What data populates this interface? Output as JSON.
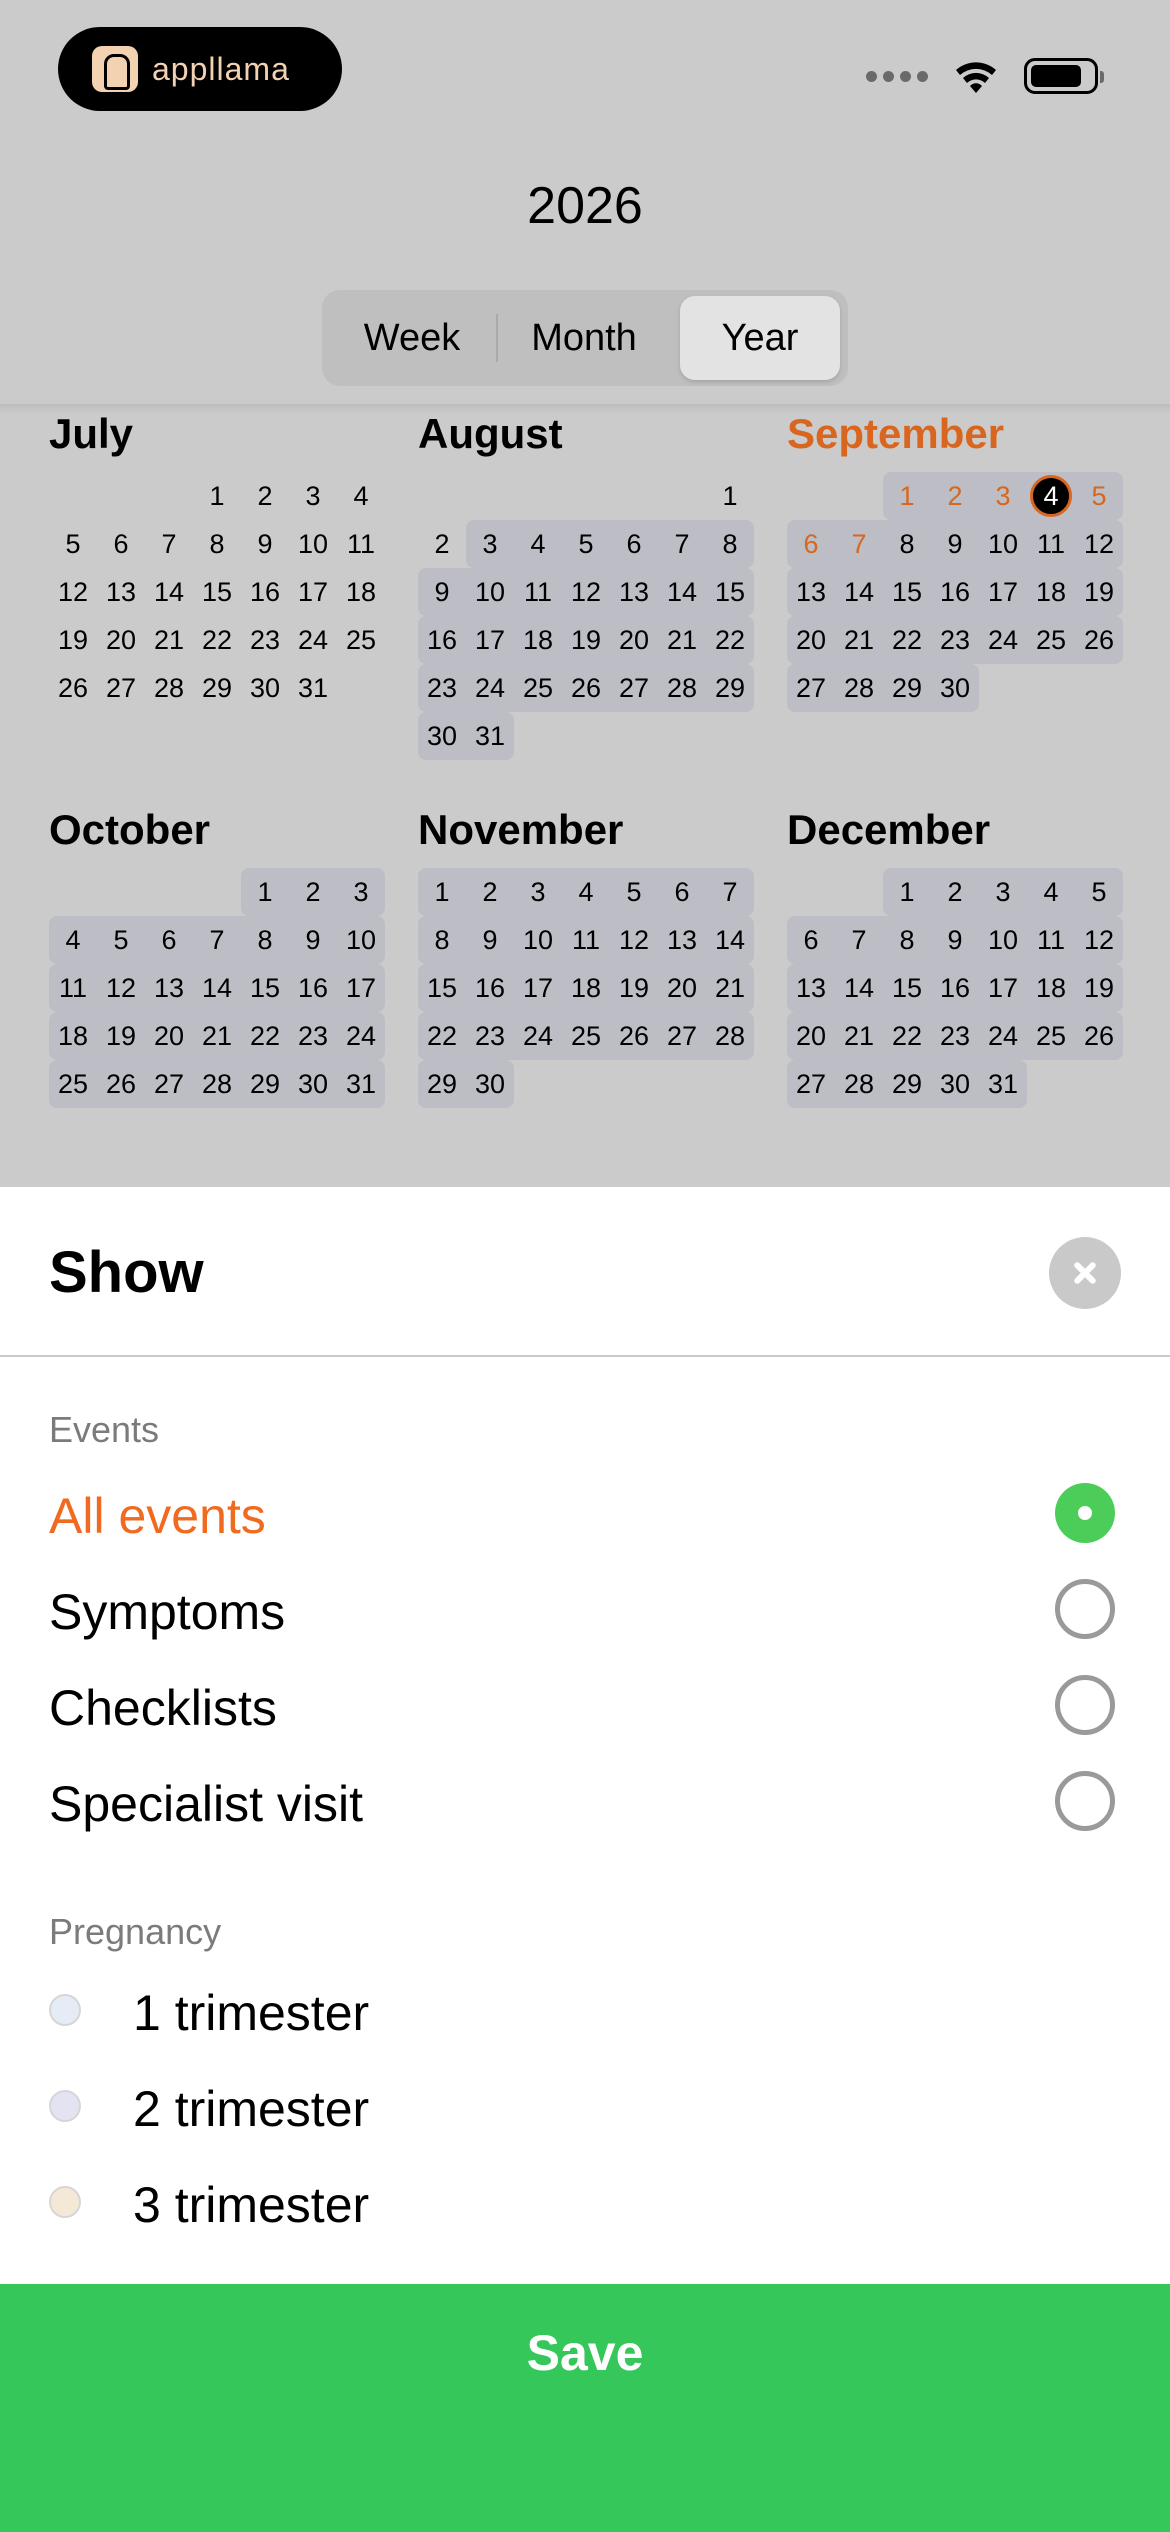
{
  "app": {
    "badge_text": "appllama",
    "badge_icon": "llama-icon"
  },
  "status_bar": {
    "icons": [
      "signal-icon",
      "wifi-icon",
      "battery-icon"
    ]
  },
  "header": {
    "year": "2026",
    "view_tabs": [
      {
        "label": "Week",
        "selected": false
      },
      {
        "label": "Month",
        "selected": false
      },
      {
        "label": "Year",
        "selected": true
      }
    ]
  },
  "months": [
    {
      "name": "July",
      "first_weekday": 3,
      "days": 31,
      "current": false,
      "range": null,
      "orange": [],
      "today": null
    },
    {
      "name": "August",
      "first_weekday": 6,
      "days": 31,
      "current": false,
      "range": [
        3,
        31
      ],
      "orange": [],
      "today": null
    },
    {
      "name": "September",
      "first_weekday": 2,
      "days": 30,
      "current": true,
      "range": [
        1,
        30
      ],
      "orange": [
        1,
        2,
        3,
        5,
        6,
        7
      ],
      "today": 4
    },
    {
      "name": "October",
      "first_weekday": 4,
      "days": 31,
      "current": false,
      "range": [
        1,
        31
      ],
      "orange": [],
      "today": null
    },
    {
      "name": "November",
      "first_weekday": 0,
      "days": 30,
      "current": false,
      "range": [
        1,
        30
      ],
      "orange": [],
      "today": null
    },
    {
      "name": "December",
      "first_weekday": 2,
      "days": 31,
      "current": false,
      "range": [
        1,
        31
      ],
      "orange": [],
      "today": null
    }
  ],
  "colors": {
    "accent_orange": "#d8661f",
    "selected_orange": "#f06a1f",
    "highlight": "#bdbdc6",
    "green": "#35c759",
    "radio_on": "#4ccd59",
    "trimester_1": "#e6ecf5",
    "trimester_2": "#e3e3f3",
    "trimester_3": "#f6e8d6"
  },
  "sheet": {
    "title": "Show",
    "close_icon": "close-icon",
    "events_label": "Events",
    "events": [
      {
        "label": "All events",
        "selected": true
      },
      {
        "label": "Symptoms",
        "selected": false
      },
      {
        "label": "Checklists",
        "selected": false
      },
      {
        "label": "Specialist visit",
        "selected": false
      }
    ],
    "pregnancy_label": "Pregnancy",
    "trimesters": [
      {
        "label": "1 trimester",
        "color": "#e6ecf5"
      },
      {
        "label": "2 trimester",
        "color": "#e3e3f3"
      },
      {
        "label": "3 trimester",
        "color": "#f6e8d6"
      }
    ],
    "save_label": "Save"
  }
}
